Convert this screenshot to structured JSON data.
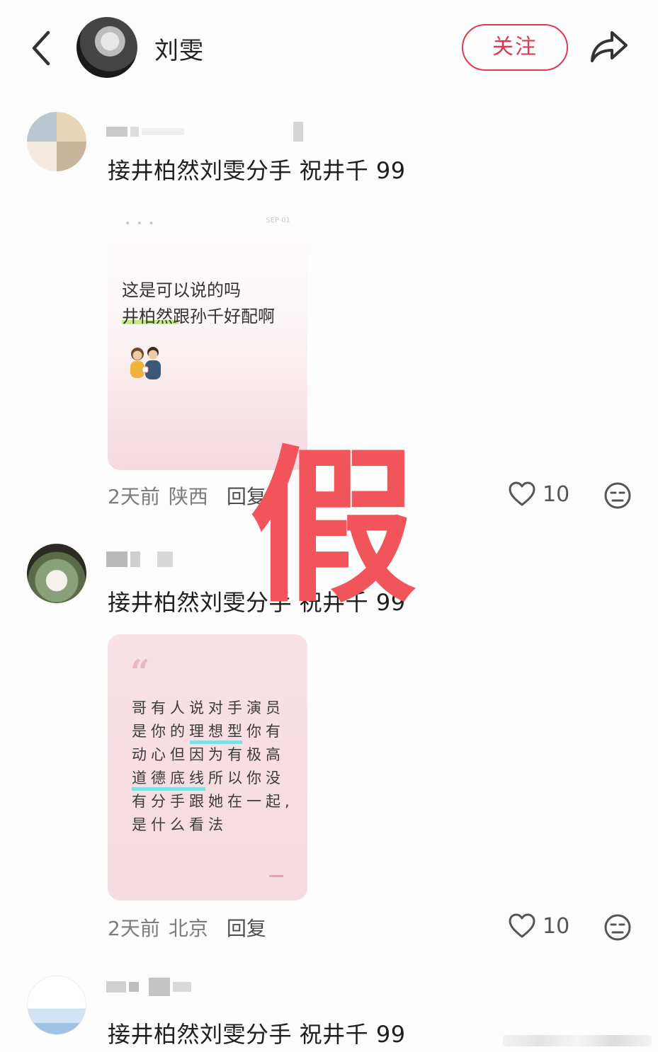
{
  "header": {
    "author_name": "刘雯",
    "follow_label": "关注"
  },
  "comments": [
    {
      "text": "接井柏然刘雯分手 祝井千 99",
      "image": {
        "lines": [
          "这是可以说的吗",
          "井柏然跟孙千好配啊"
        ],
        "tag": "SEP 01"
      },
      "time": "2天前",
      "location": "陕西",
      "reply_label": "回复",
      "likes": "10"
    },
    {
      "text": "接井柏然刘雯分手 祝井千 99",
      "image": {
        "lines": [
          "哥有人说对手演员",
          "是你的理想型你有",
          "动心但因为有极高",
          "道德底线所以你没",
          "有分手跟她在一起,",
          "是什么看法"
        ]
      },
      "time": "2天前",
      "location": "北京",
      "reply_label": "回复",
      "likes": "10"
    },
    {
      "text": "接井柏然刘雯分手 祝井千 99"
    }
  ],
  "overlay": {
    "stamp_text": "假"
  },
  "colors": {
    "accent": "#e03a52",
    "stamp": "#f2545b"
  },
  "icons": [
    "back-arrow-icon",
    "share-icon",
    "heart-icon",
    "emoji-react-icon"
  ]
}
